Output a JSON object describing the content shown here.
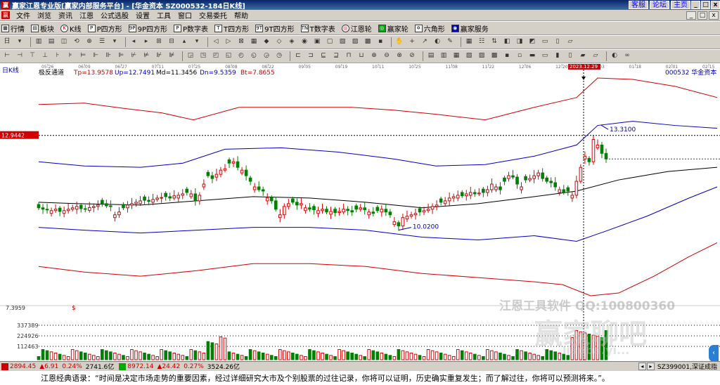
{
  "window": {
    "title": "赢家江恩专业版[赢家内部服务平台] - [华金资本  SZ000532-184日K线]",
    "logo_text": "赢",
    "top_buttons": [
      "客服",
      "论坛",
      "主页"
    ],
    "win_buttons": [
      "_",
      "□",
      "x"
    ]
  },
  "menu": {
    "logo_text": "赢",
    "items": [
      "文件",
      "浏览",
      "资讯",
      "江恩",
      "公式选股",
      "设置",
      "工具",
      "窗口",
      "交易委托",
      "帮助"
    ],
    "right_buttons": [
      "_",
      "□",
      "x"
    ]
  },
  "toolbar1": [
    {
      "icon": "grid",
      "label": "行情"
    },
    {
      "icon": "blocks",
      "label": "板块"
    },
    {
      "icon": "k",
      "label": "K线"
    },
    {
      "icon": "p",
      "label": "P四方形"
    },
    {
      "icon": "9p",
      "label": "9P四方形"
    },
    {
      "icon": "p",
      "label": "P数字表"
    },
    {
      "icon": "t",
      "label": "T四方形"
    },
    {
      "icon": "9t",
      "label": "9T四方形"
    },
    {
      "icon": "tn",
      "label": "T数字表"
    },
    {
      "icon": "circle",
      "label": "江恩轮"
    },
    {
      "icon": "circle",
      "label": "赢家轮"
    },
    {
      "icon": "star",
      "label": "六角形"
    },
    {
      "icon": "service",
      "label": "赢家服务"
    }
  ],
  "chart": {
    "period_label": "日K线",
    "indicator_name": "极反通道",
    "params": [
      {
        "name": "Tp",
        "value": "13.9578",
        "color": "#d00000"
      },
      {
        "name": "Up",
        "value": "12.7491",
        "color": "#0000c0"
      },
      {
        "name": "Md",
        "value": "11.3456",
        "color": "#000000"
      },
      {
        "name": "Dn",
        "value": "9.5359",
        "color": "#0000c0"
      },
      {
        "name": "Bt",
        "value": "7.8655",
        "color": "#d00000"
      }
    ],
    "stock_code": "000532",
    "stock_name": "华金资本",
    "date_ticks": [
      "05-26",
      "06-09",
      "06-27",
      "07-11",
      "07-25",
      "08-08",
      "08-22",
      "09-05",
      "09-19",
      "10-11",
      "10-25",
      "11-08",
      "11-22",
      "12-06",
      "12-20",
      "01-03",
      "01-18",
      "02-01",
      "02-15"
    ],
    "cursor_date": "2023.12.29",
    "price_marker": "12.9442",
    "high_label": "13.3100",
    "low_label": "10.0200",
    "volume_ticks": [
      "7.3959",
      "337389",
      "224926",
      "112463"
    ],
    "watermark_main": "江恩工具软件  QQ:100800360",
    "watermark_logo": "赢家聊吧",
    "watermark_url": "liaoba.yi...",
    "colors": {
      "up": "#e00000",
      "down": "#008000",
      "top_band": "#d00000",
      "mid_band": "#0000c0",
      "md_line": "#000000"
    }
  },
  "status": {
    "index1_value": "2894.45",
    "index1_change": "▲6.91",
    "index1_pct": "0.24%",
    "index1_amount": "2741.6亿",
    "index2_value": "8972.14",
    "index2_change": "▲24.42",
    "index2_pct": "0.27%",
    "index2_amount": "3524.26亿",
    "right_text": "SZ399001,深证成指"
  },
  "quote": "江恩经典语录：“时间是决定市场走势的重要因素，经过详细研究大市及个别股票的过往记录，你将可以证明，历史确实重复发生；而了解过往，你将可以预测将来。”。"
}
